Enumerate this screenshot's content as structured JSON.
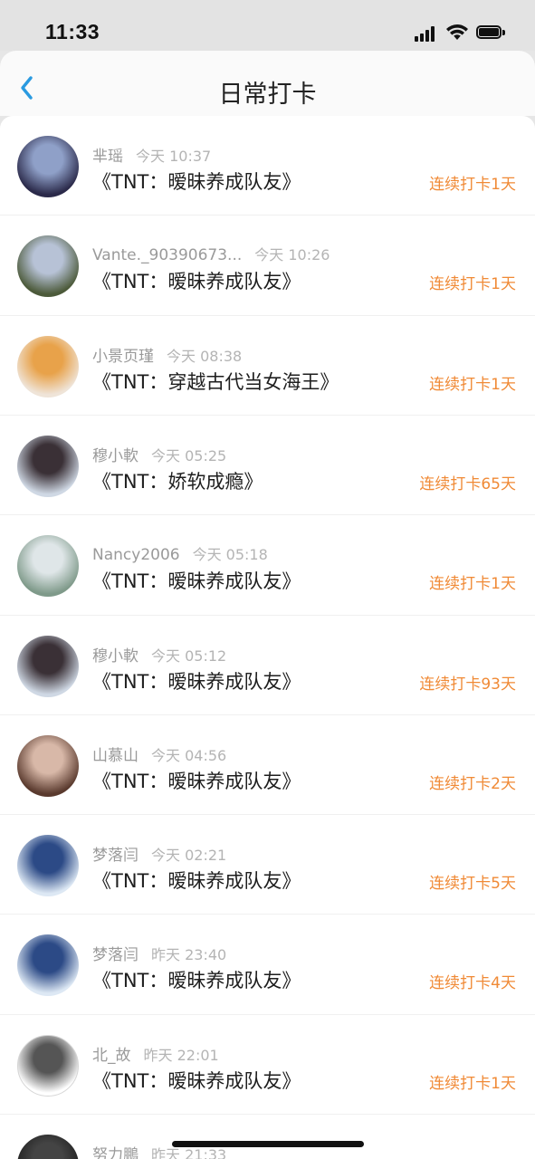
{
  "status_bar": {
    "time": "11:33"
  },
  "header": {
    "title": "日常打卡"
  },
  "accent_color": "#f08a36",
  "records": [
    {
      "user": "芈瑶",
      "when": "今天 10:37",
      "book": "《TNT：暧昧养成队友》",
      "streak": "连续打卡1天",
      "avatar_colors": [
        "#2b2a4a",
        "#8fa0c8"
      ]
    },
    {
      "user": "Vante._90390673...",
      "when": "今天 10:26",
      "book": "《TNT：暧昧养成队友》",
      "streak": "连续打卡1天",
      "avatar_colors": [
        "#4c5a3a",
        "#b7c2d6"
      ]
    },
    {
      "user": "小景页瑾",
      "when": "今天 08:38",
      "book": "《TNT：穿越古代当女海王》",
      "streak": "连续打卡1天",
      "avatar_colors": [
        "#efe4d8",
        "#e8a24a"
      ]
    },
    {
      "user": "穆小軟",
      "when": "今天 05:25",
      "book": "《TNT：娇软成瘾》",
      "streak": "连续打卡65天",
      "avatar_colors": [
        "#cfd8e4",
        "#3a3036"
      ]
    },
    {
      "user": "Nancy2006",
      "when": "今天 05:18",
      "book": "《TNT：暧昧养成队友》",
      "streak": "连续打卡1天",
      "avatar_colors": [
        "#7f9a8a",
        "#dfe6e8"
      ]
    },
    {
      "user": "穆小軟",
      "when": "今天 05:12",
      "book": "《TNT：暧昧养成队友》",
      "streak": "连续打卡93天",
      "avatar_colors": [
        "#cfd8e4",
        "#3a3036"
      ]
    },
    {
      "user": "山慕山",
      "when": "今天 04:56",
      "book": "《TNT：暧昧养成队友》",
      "streak": "连续打卡2天",
      "avatar_colors": [
        "#5a3a2e",
        "#d8b8a8"
      ]
    },
    {
      "user": "梦落闫",
      "when": "今天 02:21",
      "book": "《TNT：暧昧养成队友》",
      "streak": "连续打卡5天",
      "avatar_colors": [
        "#dde8f4",
        "#2c4a86"
      ]
    },
    {
      "user": "梦落闫",
      "when": "昨天 23:40",
      "book": "《TNT：暧昧养成队友》",
      "streak": "连续打卡4天",
      "avatar_colors": [
        "#dde8f4",
        "#2c4a86"
      ]
    },
    {
      "user": "北_故",
      "when": "昨天 22:01",
      "book": "《TNT：暧昧养成队友》",
      "streak": "连续打卡1天",
      "avatar_colors": [
        "#ffffff",
        "#555555"
      ]
    },
    {
      "user": "努力鵬",
      "when": "昨天 21:33",
      "book": "",
      "streak": "",
      "avatar_colors": [
        "#1e1e1e",
        "#444444"
      ]
    }
  ]
}
